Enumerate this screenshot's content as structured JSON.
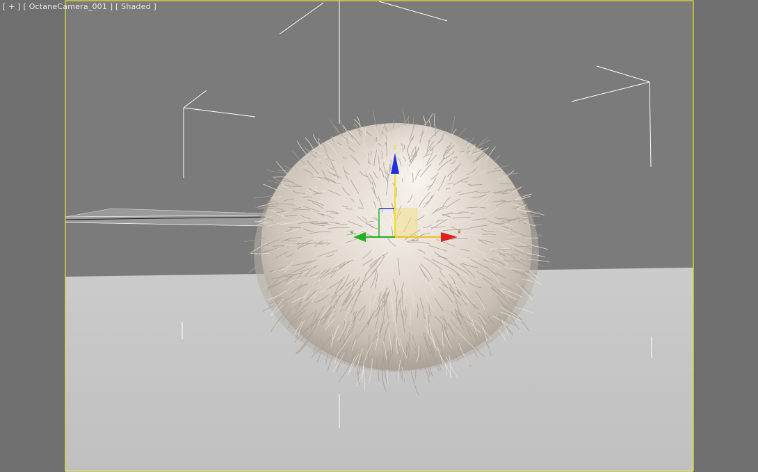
{
  "viewport": {
    "label_plus": "[ + ]",
    "label_camera": "[ OctaneCamera_001 ]",
    "label_mode": "[ Shaded ]",
    "background_color": "#7b7b7b",
    "safe_frame_color": "#e6e62a",
    "floor_color": "#c4c4c4",
    "object": "fur-ball",
    "fur_color": "#cfc6bc"
  },
  "gizmo": {
    "type": "move",
    "axes": [
      {
        "name": "x",
        "color": "#e02020",
        "label": "x"
      },
      {
        "name": "y",
        "color": "#20b020",
        "label": "y"
      },
      {
        "name": "z",
        "color": "#2030e0",
        "label": "z"
      }
    ]
  }
}
